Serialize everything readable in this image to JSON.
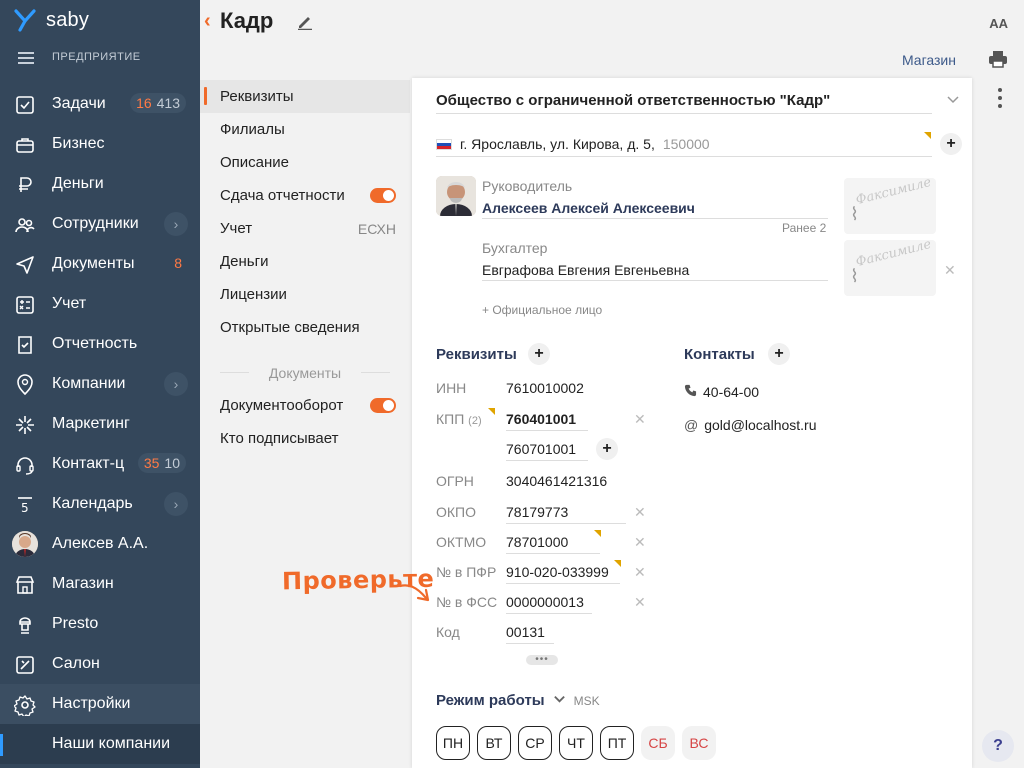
{
  "app": {
    "brand": "saby",
    "workspace": "ПРЕДПРИЯТИЕ"
  },
  "sidebar": {
    "items": [
      {
        "label": "Задачи",
        "icon": "tasks-icon",
        "badge_red": "16",
        "badge_gray": "413"
      },
      {
        "label": "Бизнес",
        "icon": "business-icon"
      },
      {
        "label": "Деньги",
        "icon": "money-icon"
      },
      {
        "label": "Сотрудники",
        "icon": "employees-icon",
        "expand": true
      },
      {
        "label": "Документы",
        "icon": "documents-icon",
        "badge_red": "8"
      },
      {
        "label": "Учет",
        "icon": "accounting-icon"
      },
      {
        "label": "Отчетность",
        "icon": "reporting-icon"
      },
      {
        "label": "Компании",
        "icon": "companies-icon",
        "expand": true
      },
      {
        "label": "Маркетинг",
        "icon": "marketing-icon"
      },
      {
        "label": "Контакт-ц",
        "icon": "contact-center-icon",
        "badge_red": "35",
        "badge_gray": "10"
      },
      {
        "label": "Календарь",
        "icon": "calendar-icon",
        "expand": true,
        "icon_text": "5"
      },
      {
        "label": "Алексев А.А.",
        "icon": "user-avatar-icon"
      },
      {
        "label": "Магазин",
        "icon": "shop-icon"
      },
      {
        "label": "Presto",
        "icon": "presto-icon"
      },
      {
        "label": "Салон",
        "icon": "salon-icon"
      },
      {
        "label": "Настройки",
        "icon": "settings-icon"
      },
      {
        "label": "Наши компании",
        "icon": ""
      }
    ]
  },
  "header": {
    "title": "Кадр",
    "font_size_label": "AA",
    "shop_link": "Магазин"
  },
  "menu": {
    "items": [
      {
        "label": "Реквизиты",
        "active": true
      },
      {
        "label": "Филиалы"
      },
      {
        "label": "Описание"
      },
      {
        "label": "Сдача отчетности",
        "toggle": true
      },
      {
        "label": "Учет",
        "right": "ЕСХН"
      },
      {
        "label": "Деньги"
      },
      {
        "label": "Лицензии"
      },
      {
        "label": "Открытые сведения"
      }
    ],
    "divider": "Документы",
    "items2": [
      {
        "label": "Документооборот",
        "toggle": true
      },
      {
        "label": "Кто подписывает"
      }
    ]
  },
  "card": {
    "org_name": "Общество с ограниченной ответственностью \"Кадр\"",
    "address": "г. Ярославль, ул. Кирова, д. 5,",
    "zip": "150000",
    "director": {
      "role": "Руководитель",
      "name": "Алексеев Алексей Алексеевич",
      "earlier": "Ранее 2"
    },
    "accountant": {
      "role": "Бухгалтер",
      "name": "Евграфова Евгения Евгеньевна"
    },
    "facsimile_text": "Факсимиле",
    "add_official": "+ Официальное лицо",
    "requisites_title": "Реквизиты",
    "contacts_title": "Контакты",
    "requisites": {
      "inn_label": "ИНН",
      "inn": "7610010002",
      "kpp_label": "КПП",
      "kpp_count": "(2)",
      "kpp1": "760401001",
      "kpp2": "760701001",
      "ogrn_label": "ОГРН",
      "ogrn": "3040461421316",
      "okpo_label": "ОКПО",
      "okpo": "78179773",
      "oktmo_label": "ОКТМО",
      "oktmo": "78701000",
      "pfr_label": "№ в ПФР",
      "pfr": "910-020-033999",
      "fss_label": "№ в ФСС",
      "fss": "0000000013",
      "kod_label": "Код",
      "kod": "00131"
    },
    "contacts": {
      "phone": "40-64-00",
      "email": "gold@localhost.ru"
    },
    "mode_title": "Режим работы",
    "mode_tz": "MSK",
    "days": [
      {
        "label": "ПН",
        "off": false
      },
      {
        "label": "ВТ",
        "off": false
      },
      {
        "label": "СР",
        "off": false
      },
      {
        "label": "ЧТ",
        "off": false
      },
      {
        "label": "ПТ",
        "off": false
      },
      {
        "label": "СБ",
        "off": true
      },
      {
        "label": "ВС",
        "off": true
      }
    ]
  },
  "annotation": "Проверьте",
  "help_label": "?",
  "colors": {
    "sidebar": "#34475b",
    "accent": "#f06a2a",
    "marker": "#e0a400",
    "link": "#3d5a8a"
  }
}
